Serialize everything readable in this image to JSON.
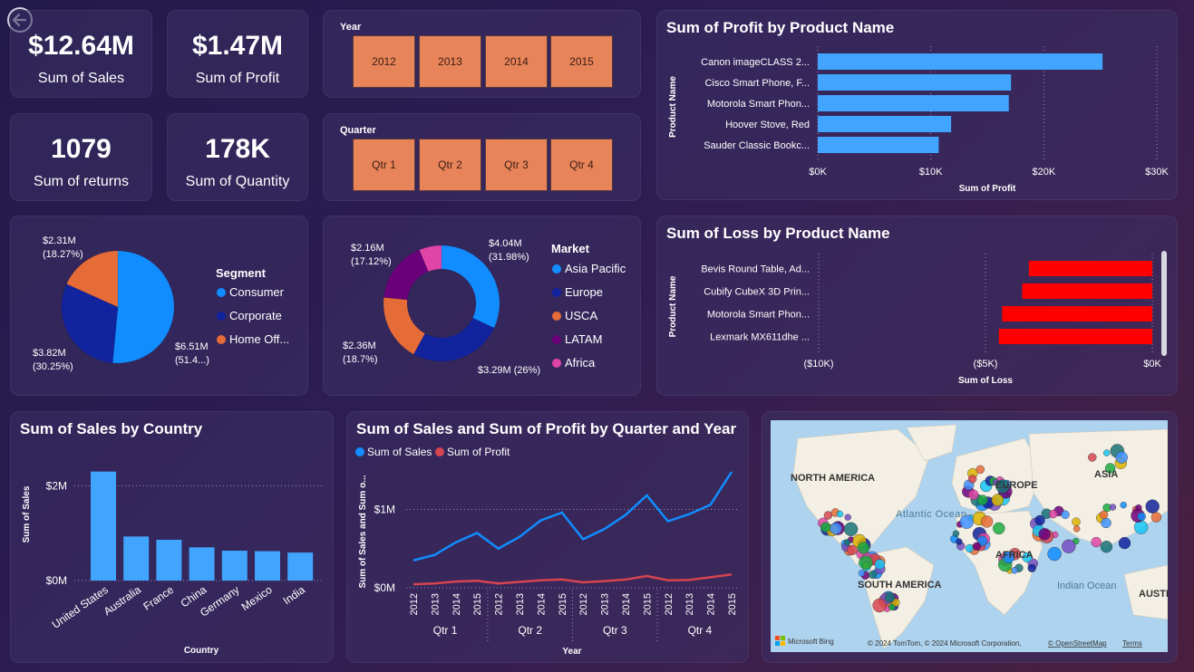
{
  "kpis": [
    {
      "value": "$12.64M",
      "label": "Sum of Sales"
    },
    {
      "value": "$1.47M",
      "label": "Sum of Profit"
    },
    {
      "value": "1079",
      "label": "Sum of returns"
    },
    {
      "value": "178K",
      "label": "Sum of Quantity"
    }
  ],
  "slicers": {
    "year": {
      "title": "Year",
      "options": [
        "2012",
        "2013",
        "2014",
        "2015"
      ]
    },
    "quarter": {
      "title": "Quarter",
      "options": [
        "Qtr 1",
        "Qtr 2",
        "Qtr 3",
        "Qtr 4"
      ]
    }
  },
  "segment_legend": {
    "title": "Segment",
    "items": [
      "Consumer",
      "Corporate",
      "Home Off..."
    ]
  },
  "market_legend": {
    "title": "Market",
    "items": [
      "Asia Pacific",
      "Europe",
      "USCA",
      "LATAM",
      "Africa"
    ]
  },
  "colors": {
    "consumer": "#118dff",
    "corporate": "#12239e",
    "home_office": "#e66c37",
    "asia_pacific": "#118dff",
    "europe": "#12239e",
    "usca": "#e66c37",
    "latam": "#6b007b",
    "africa": "#e044a7",
    "profit_bar": "#41a4ff",
    "loss_bar": "#ff0000",
    "sales_line": "#118dff",
    "profit_line": "#d64550"
  },
  "map": {
    "labels": [
      "NORTH AMERICA",
      "EUROPE",
      "ASIA",
      "Atlantic Ocean",
      "AFRICA",
      "SOUTH AMERICA",
      "Indian Ocean",
      "AUSTRA"
    ],
    "attribution": "© 2024 TomTom, © 2024 Microsoft Corporation,",
    "osm_link": "© OpenStreetMap",
    "terms_link": "Terms",
    "brand": "Microsoft Bing"
  },
  "chart_data": [
    {
      "type": "pie",
      "title": "",
      "legend_title": "Segment",
      "slices": [
        {
          "name": "Consumer",
          "value": 6.51,
          "label": "$6.51M",
          "pct_label": "(51.4...)"
        },
        {
          "name": "Corporate",
          "value": 3.82,
          "label": "$3.82M",
          "pct_label": "(30.25%)"
        },
        {
          "name": "Home Off...",
          "value": 2.31,
          "label": "$2.31M",
          "pct_label": "(18.27%)"
        }
      ]
    },
    {
      "type": "pie",
      "subtype": "donut",
      "title": "",
      "legend_title": "Market",
      "slices": [
        {
          "name": "Asia Pacific",
          "value": 4.04,
          "label": "$4.04M",
          "pct_label": "(31.98%)"
        },
        {
          "name": "Europe",
          "value": 3.29,
          "label": "$3.29M (26%)",
          "pct_label": ""
        },
        {
          "name": "USCA",
          "value": 2.36,
          "label": "$2.36M",
          "pct_label": "(18.7%)"
        },
        {
          "name": "LATAM",
          "value": 2.16,
          "label": "$2.16M",
          "pct_label": "(17.12%)"
        },
        {
          "name": "Africa",
          "value": 0.79,
          "label": "",
          "pct_label": ""
        }
      ]
    },
    {
      "type": "bar",
      "orientation": "horizontal",
      "title": "Sum of Profit by Product Name",
      "xlabel": "Sum of Profit",
      "ylabel": "Product Name",
      "categories": [
        "Canon imageCLASS 2...",
        "Cisco Smart Phone, F...",
        "Motorola Smart Phon...",
        "Hoover Stove, Red",
        "Sauder Classic Bookc..."
      ],
      "values": [
        25200,
        17100,
        16900,
        11800,
        10700
      ],
      "xlim": [
        0,
        30000
      ],
      "xticks": [
        "$0K",
        "$10K",
        "$20K",
        "$30K"
      ]
    },
    {
      "type": "bar",
      "orientation": "horizontal",
      "title": "Sum of Loss by Product Name",
      "xlabel": "Sum of Loss",
      "ylabel": "Product Name",
      "categories": [
        "Bevis Round Table, Ad...",
        "Cubify CubeX 3D Prin...",
        "Motorola Smart Phon...",
        "Lexmark MX611dhe ..."
      ],
      "values": [
        -3700,
        -3900,
        -4500,
        -4600
      ],
      "xlim": [
        -10000,
        0
      ],
      "xticks": [
        "($10K)",
        "($5K)",
        "$0K"
      ]
    },
    {
      "type": "bar",
      "title": "Sum of Sales by Country",
      "xlabel": "Country",
      "ylabel": "Sum of Sales",
      "categories": [
        "United States",
        "Australia",
        "France",
        "China",
        "Germany",
        "Mexico",
        "India"
      ],
      "values": [
        2300000,
        930000,
        860000,
        700000,
        630000,
        620000,
        590000
      ],
      "ylim": [
        0,
        2600000
      ],
      "yticks": [
        "$0M",
        "$2M"
      ]
    },
    {
      "type": "line",
      "title": "Sum of Sales and Sum of Profit by Quarter and Year",
      "xlabel": "Year",
      "ylabel": "Sum of Sales and Sum o...",
      "x_quarters": [
        "Qtr 1",
        "Qtr 2",
        "Qtr 3",
        "Qtr 4"
      ],
      "x_years": [
        "2012",
        "2013",
        "2014",
        "2015"
      ],
      "ylim": [
        0,
        1550000
      ],
      "yticks": [
        "$0M",
        "$1M"
      ],
      "series": [
        {
          "name": "Sum of Sales",
          "values": [
            350000,
            420000,
            580000,
            700000,
            500000,
            650000,
            860000,
            960000,
            620000,
            750000,
            930000,
            1180000,
            850000,
            940000,
            1060000,
            1480000
          ]
        },
        {
          "name": "Sum of Profit",
          "values": [
            45000,
            55000,
            80000,
            90000,
            55000,
            75000,
            95000,
            105000,
            70000,
            85000,
            105000,
            150000,
            95000,
            100000,
            135000,
            170000
          ]
        }
      ]
    }
  ]
}
